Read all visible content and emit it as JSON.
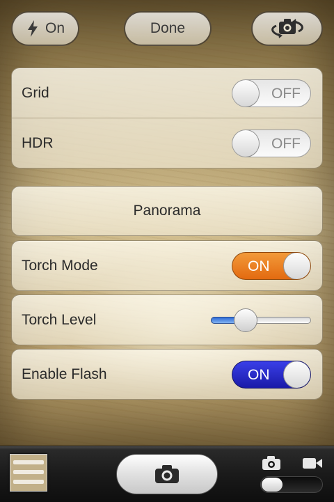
{
  "topbar": {
    "flash_label": "On",
    "done_label": "Done"
  },
  "settings": {
    "grid": {
      "label": "Grid",
      "state": "OFF"
    },
    "hdr": {
      "label": "HDR",
      "state": "OFF"
    },
    "panorama_label": "Panorama",
    "torch_mode": {
      "label": "Torch Mode",
      "state": "ON"
    },
    "torch_level": {
      "label": "Torch Level",
      "value": 0.35
    },
    "enable_flash": {
      "label": "Enable Flash",
      "state": "ON"
    }
  },
  "colors": {
    "torch_toggle_on": "#e87818",
    "flash_toggle_on": "#2222c8",
    "slider_fill": "#4a8ae0"
  },
  "icons": {
    "flash": "lightning-bolt-icon",
    "switch_camera": "camera-rotate-icon",
    "shutter": "camera-icon",
    "photo_mode": "camera-icon",
    "video_mode": "video-camera-icon"
  }
}
